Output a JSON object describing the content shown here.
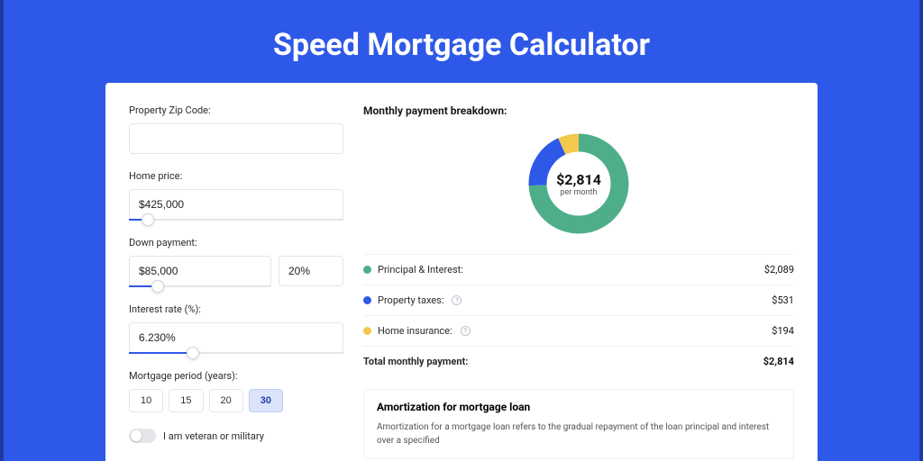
{
  "title": "Speed Mortgage Calculator",
  "form": {
    "zip_label": "Property Zip Code:",
    "zip_value": "",
    "home_price_label": "Home price:",
    "home_price_value": "$425,000",
    "home_price_slider_pct": 9,
    "down_label": "Down payment:",
    "down_value": "$85,000",
    "down_pct_value": "20%",
    "down_slider_pct": 20,
    "rate_label": "Interest rate (%):",
    "rate_value": "6.230%",
    "rate_slider_pct": 30,
    "period_label": "Mortgage period (years):",
    "period_options": [
      "10",
      "15",
      "20",
      "30"
    ],
    "period_selected": "30",
    "veteran_label": "I am veteran or military"
  },
  "breakdown": {
    "title": "Monthly payment breakdown:",
    "total_value": "$2,814",
    "total_sub": "per month",
    "rows": [
      {
        "label": "Principal & Interest:",
        "value": "$2,089",
        "color": "green",
        "info": false
      },
      {
        "label": "Property taxes:",
        "value": "$531",
        "color": "blue",
        "info": true
      },
      {
        "label": "Home insurance:",
        "value": "$194",
        "color": "yellow",
        "info": true
      }
    ],
    "total_row_label": "Total monthly payment:",
    "total_row_value": "$2,814"
  },
  "amort": {
    "title": "Amortization for mortgage loan",
    "body": "Amortization for a mortgage loan refers to the gradual repayment of the loan principal and interest over a specified"
  },
  "chart_data": {
    "type": "pie",
    "title": "Monthly payment breakdown",
    "series": [
      {
        "name": "Principal & Interest",
        "value": 2089,
        "color": "#4fae8a"
      },
      {
        "name": "Property taxes",
        "value": 531,
        "color": "#2e59e8"
      },
      {
        "name": "Home insurance",
        "value": 194,
        "color": "#f2c94c"
      }
    ],
    "total": 2814,
    "unit": "USD per month"
  }
}
